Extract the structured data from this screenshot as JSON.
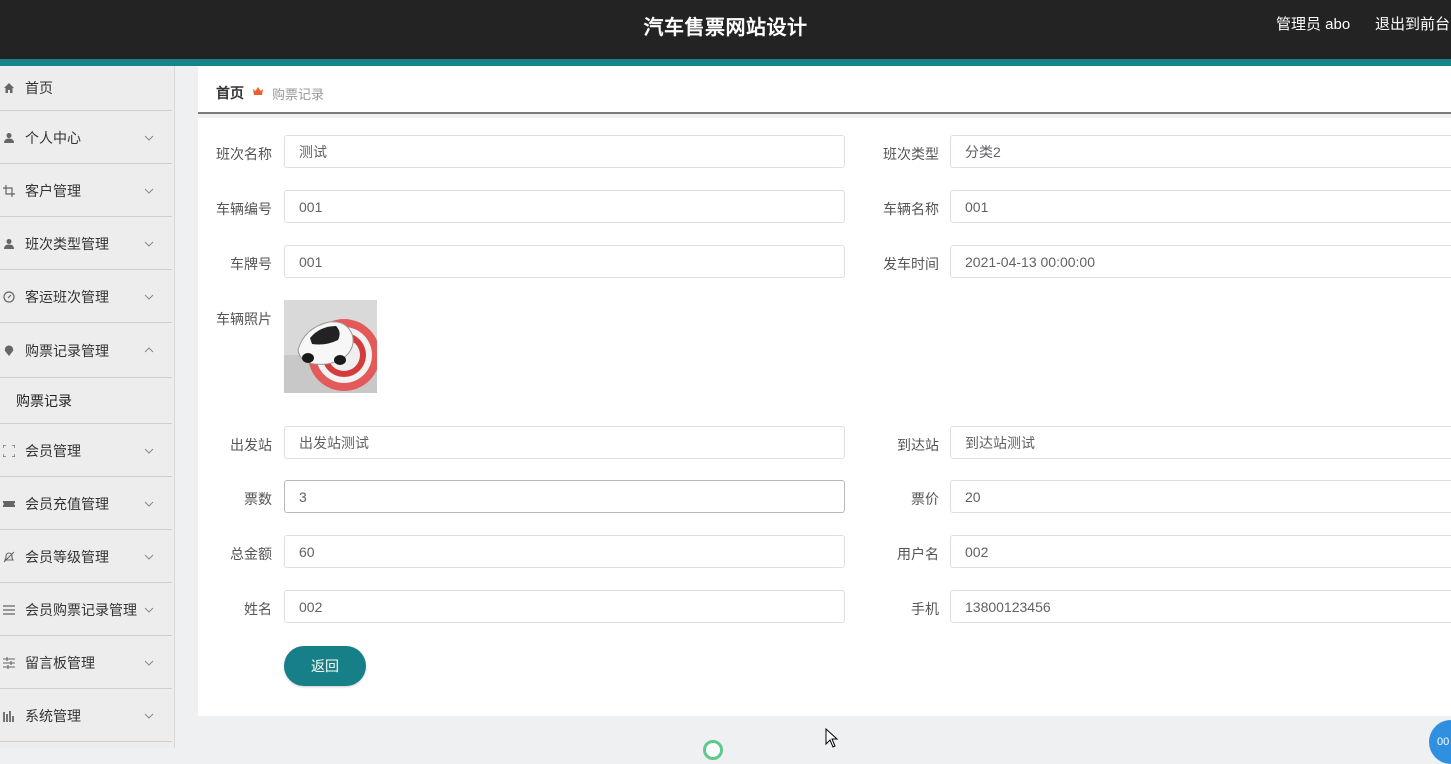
{
  "header": {
    "title": "汽车售票网站设计",
    "admin": "管理员 abo",
    "exit": "退出到前台"
  },
  "sidebar": {
    "items": [
      {
        "label": "首页",
        "icon": "home-icon"
      },
      {
        "label": "个人中心",
        "icon": "user-icon"
      },
      {
        "label": "客户管理",
        "icon": "crop-icon"
      },
      {
        "label": "班次类型管理",
        "icon": "user-icon"
      },
      {
        "label": "客运班次管理",
        "icon": "compass-icon"
      },
      {
        "label": "购票记录管理",
        "icon": "pin-icon"
      },
      {
        "label": "会员管理",
        "icon": "fullscreen-icon"
      },
      {
        "label": "会员充值管理",
        "icon": "ticket-icon"
      },
      {
        "label": "会员等级管理",
        "icon": "bell-off-icon"
      },
      {
        "label": "会员购票记录管理",
        "icon": "list-icon"
      },
      {
        "label": "留言板管理",
        "icon": "sliders-icon"
      },
      {
        "label": "系统管理",
        "icon": "chart-icon"
      }
    ],
    "sub_item": "购票记录"
  },
  "breadcrumb": {
    "home": "首页",
    "current": "购票记录"
  },
  "form": {
    "class_name_label": "班次名称",
    "class_name_value": "测试",
    "class_type_label": "班次类型",
    "class_type_value": "分类2",
    "vehicle_no_label": "车辆编号",
    "vehicle_no_value": "001",
    "vehicle_name_label": "车辆名称",
    "vehicle_name_value": "001",
    "plate_label": "车牌号",
    "plate_value": "001",
    "depart_time_label": "发车时间",
    "depart_time_value": "2021-04-13 00:00:00",
    "photo_label": "车辆照片",
    "from_label": "出发站",
    "from_value": "出发站测试",
    "to_label": "到达站",
    "to_value": "到达站测试",
    "tickets_label": "票数",
    "tickets_value": "3",
    "price_label": "票价",
    "price_value": "20",
    "total_label": "总金额",
    "total_value": "60",
    "username_label": "用户名",
    "username_value": "002",
    "name_label": "姓名",
    "name_value": "002",
    "phone_label": "手机",
    "phone_value": "13800123456",
    "back_button": "返回"
  },
  "float_badge": "00",
  "colors": {
    "header_bg": "#232323",
    "accent": "#17838d",
    "button": "#167f87"
  }
}
